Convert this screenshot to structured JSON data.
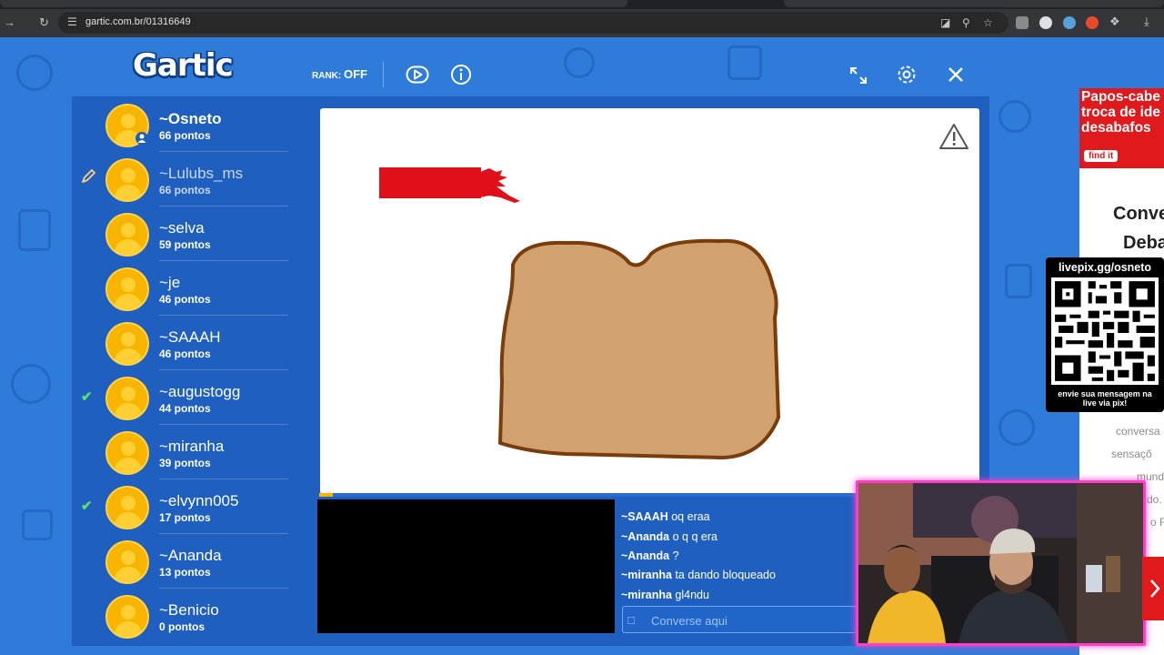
{
  "browser": {
    "url": "gartic.com.br/01316649",
    "back_icon": "arrow-left-icon",
    "reload_icon": "reload-icon"
  },
  "header": {
    "logo": "Gartic",
    "rank_label": "RANK:",
    "rank_value": "OFF"
  },
  "players": [
    {
      "name": "~Osneto",
      "points": "66 pontos",
      "state": "owner"
    },
    {
      "name": "~Lulubs_ms",
      "points": "66 pontos",
      "state": "drawing"
    },
    {
      "name": "~selva",
      "points": "59 pontos",
      "state": ""
    },
    {
      "name": "~je",
      "points": "46 pontos",
      "state": ""
    },
    {
      "name": "~SAAAH",
      "points": "46 pontos",
      "state": ""
    },
    {
      "name": "~augustogg",
      "points": "44 pontos",
      "state": "guessed"
    },
    {
      "name": "~miranha",
      "points": "39 pontos",
      "state": ""
    },
    {
      "name": "~elvynn005",
      "points": "17 pontos",
      "state": "guessed"
    },
    {
      "name": "~Ananda",
      "points": "13 pontos",
      "state": ""
    },
    {
      "name": "~Benicio",
      "points": "0 pontos",
      "state": ""
    }
  ],
  "round": {
    "progress": 0.02
  },
  "chat": {
    "messages": [
      {
        "user": "~SAAAH",
        "text": "oq eraa"
      },
      {
        "user": "~Ananda",
        "text": "o q q era"
      },
      {
        "user": "~Ananda",
        "text": "?"
      },
      {
        "user": "~miranha",
        "text": "ta dando bloqueado"
      },
      {
        "user": "~miranha",
        "text": "gl4ndu"
      }
    ],
    "placeholder": "Converse aqui"
  },
  "ad": {
    "banner_lines": [
      "Papos-cabe",
      "troca de ide",
      "desabafos"
    ],
    "banner_button": "find it",
    "heading1": "Conve",
    "heading2": "Deba",
    "body_lines": [
      "conversa",
      "sensaçõ",
      "mundo",
      "do.",
      "o F"
    ]
  },
  "qr": {
    "top": "livepix.gg/osneto",
    "bottom1": "envie sua mensagem na",
    "bottom2": "live via pix!"
  },
  "colors": {
    "background": "#2f7bd9",
    "panel": "#1f5fc0",
    "avatar": "#f7b500",
    "guessed_check": "#5be36a",
    "ad_red": "#e0191d"
  }
}
